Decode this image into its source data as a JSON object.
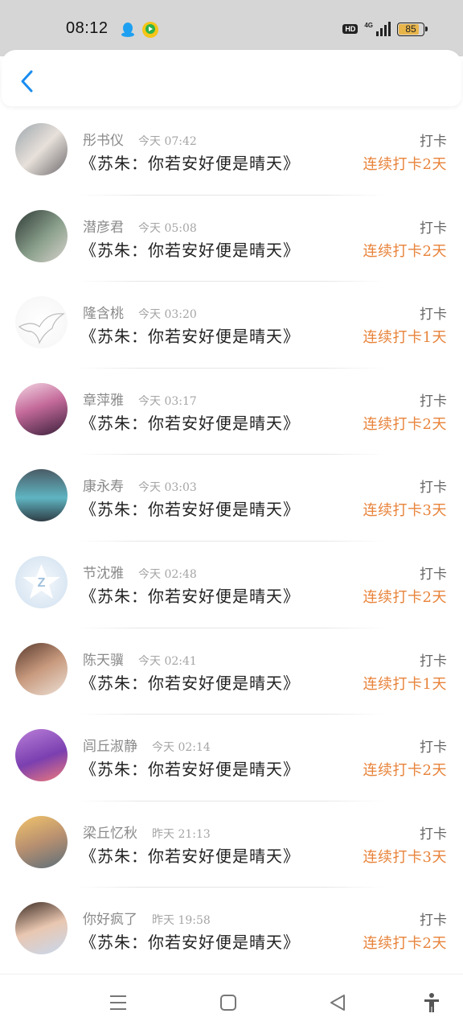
{
  "status_bar": {
    "time": "08:12",
    "network": "4G",
    "hd": "HD",
    "battery": "85",
    "battery_level": 0.85
  },
  "header": {
    "back_icon": "chevron-left-icon"
  },
  "colors": {
    "accent_blue": "#1a8cf0",
    "streak_orange": "#e8833a"
  },
  "entries": [
    {
      "name": "彤书仪",
      "time": "今天 07:42",
      "book": "《苏朱：你若安好便是晴天》",
      "checkin": "打卡",
      "streak": "连续打卡2天"
    },
    {
      "name": "潜彦君",
      "time": "今天 05:08",
      "book": "《苏朱：你若安好便是晴天》",
      "checkin": "打卡",
      "streak": "连续打卡2天"
    },
    {
      "name": "隆含桃",
      "time": "今天 03:20",
      "book": "《苏朱：你若安好便是晴天》",
      "checkin": "打卡",
      "streak": "连续打卡1天"
    },
    {
      "name": "章萍雅",
      "time": "今天 03:17",
      "book": "《苏朱：你若安好便是晴天》",
      "checkin": "打卡",
      "streak": "连续打卡2天"
    },
    {
      "name": "康永寿",
      "time": "今天 03:03",
      "book": "《苏朱：你若安好便是晴天》",
      "checkin": "打卡",
      "streak": "连续打卡3天"
    },
    {
      "name": "节沈雅",
      "time": "今天 02:48",
      "book": "《苏朱：你若安好便是晴天》",
      "checkin": "打卡",
      "streak": "连续打卡2天"
    },
    {
      "name": "陈天骥",
      "time": "今天 02:41",
      "book": "《苏朱：你若安好便是晴天》",
      "checkin": "打卡",
      "streak": "连续打卡1天"
    },
    {
      "name": "闾丘淑静",
      "time": "今天 02:14",
      "book": "《苏朱：你若安好便是晴天》",
      "checkin": "打卡",
      "streak": "连续打卡2天"
    },
    {
      "name": "梁丘忆秋",
      "time": "昨天 21:13",
      "book": "《苏朱：你若安好便是晴天》",
      "checkin": "打卡",
      "streak": "连续打卡3天"
    },
    {
      "name": "你好疯了",
      "time": "昨天 19:58",
      "book": "《苏朱：你若安好便是晴天》",
      "checkin": "打卡",
      "streak": "连续打卡2天"
    }
  ],
  "nav": {
    "icons": [
      "menu-icon",
      "home-icon",
      "back-icon",
      "accessibility-icon"
    ]
  }
}
